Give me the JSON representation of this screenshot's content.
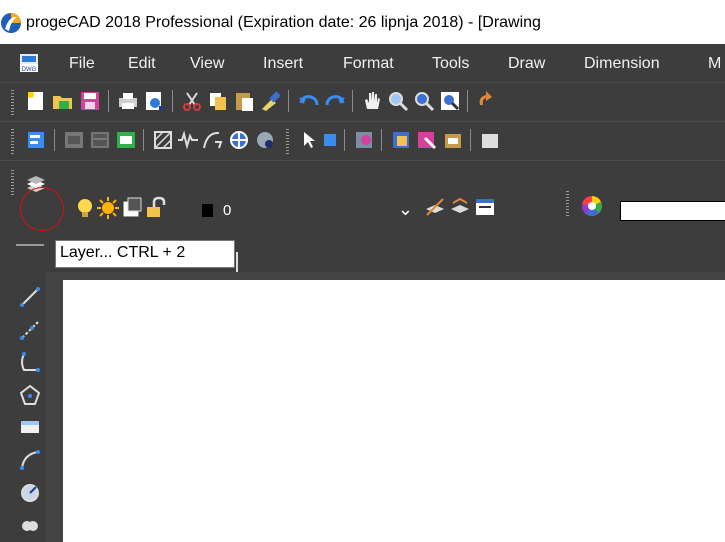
{
  "window": {
    "title": "progeCAD 2018 Professional  (Expiration date: 26 lipnja 2018) - [Drawing"
  },
  "menubar": {
    "items": [
      {
        "label": "File"
      },
      {
        "label": "Edit"
      },
      {
        "label": "View"
      },
      {
        "label": "Insert"
      },
      {
        "label": "Format"
      },
      {
        "label": "Tools"
      },
      {
        "label": "Draw"
      },
      {
        "label": "Dimension"
      },
      {
        "label": "M"
      }
    ],
    "doc_icon_label": "DWG"
  },
  "toolbars": {
    "standard_icons": [
      "new-icon",
      "open-icon",
      "save-icon",
      "print-icon",
      "print-preview-icon",
      "cut-icon",
      "copy-icon",
      "paste-icon",
      "match-properties-icon",
      "undo-icon",
      "redo-icon",
      "pan-icon",
      "zoom-realtime-icon",
      "zoom-window-icon",
      "zoom-previous-icon",
      "regen-icon"
    ],
    "properties_icons": [
      "layer-manager-icon",
      "bulb-on-icon",
      "sun-icon",
      "viewport-freeze-icon",
      "lock-open-icon",
      "layer-color-swatch"
    ],
    "layer_combo_value": "0",
    "colors": {
      "accent_red": "#e01010",
      "layer_swatch": "#000000"
    }
  },
  "tooltip": {
    "text": "Layer...  CTRL + 2"
  },
  "left_toolbar": {
    "icons": [
      "line-icon",
      "ray-icon",
      "polyline-icon",
      "polygon-icon",
      "rectangle-icon",
      "arc-icon",
      "circle-icon",
      "revision-cloud-icon"
    ]
  }
}
